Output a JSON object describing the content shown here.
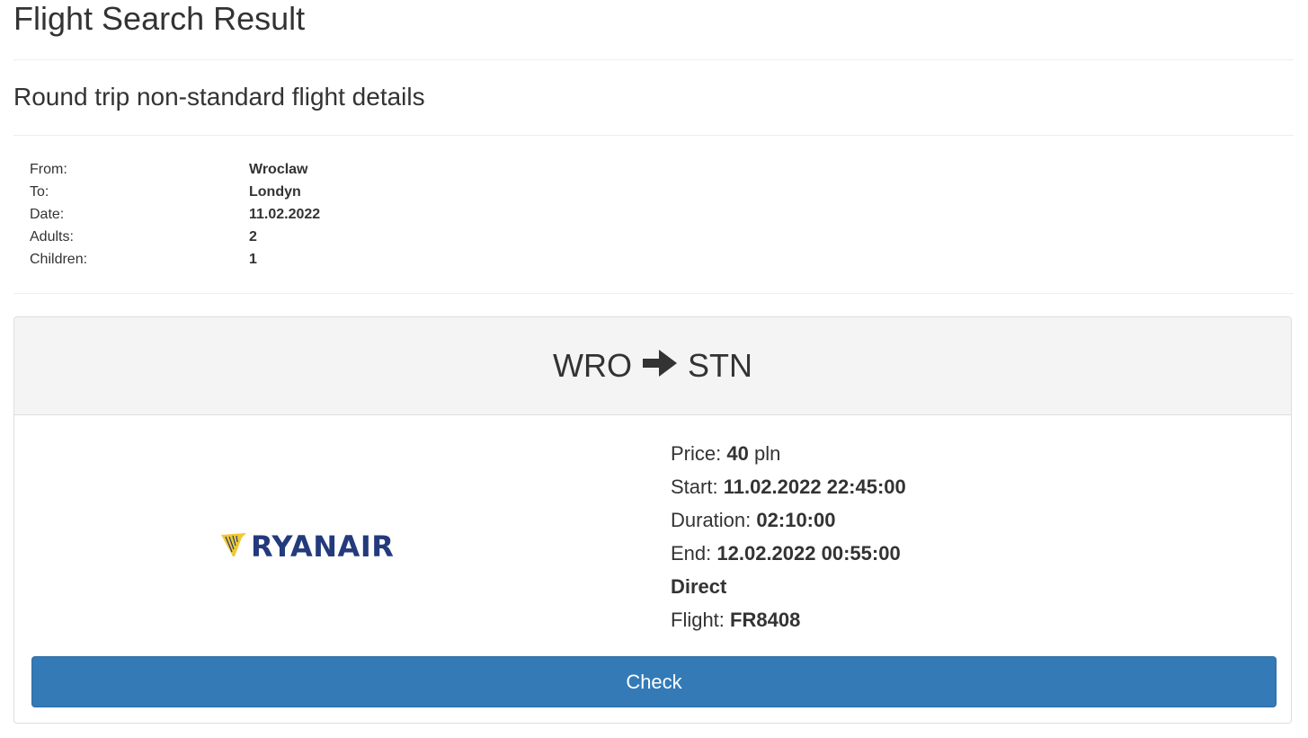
{
  "header": {
    "title": "Flight Search Result",
    "subtitle": "Round trip non-standard flight details"
  },
  "search_details": [
    {
      "label": "From:",
      "value": "Wroclaw"
    },
    {
      "label": "To:",
      "value": "Londyn"
    },
    {
      "label": "Date:",
      "value": "11.02.2022"
    },
    {
      "label": "Adults:",
      "value": "2"
    },
    {
      "label": "Children:",
      "value": "1"
    }
  ],
  "flight": {
    "origin": "WRO",
    "destination": "STN",
    "route_icon": "arrow-right-icon",
    "airline_logo_text": "RYANAIR",
    "airline_logo_icon": "ryanair-harp-icon",
    "price_label": "Price:",
    "price_value": "40",
    "price_currency": "pln",
    "start_label": "Start:",
    "start_value": "11.02.2022 22:45:00",
    "duration_label": "Duration:",
    "duration_value": "02:10:00",
    "end_label": "End:",
    "end_value": "12.02.2022 00:55:00",
    "type": "Direct",
    "flight_label": "Flight:",
    "flight_value": "FR8408",
    "check_label": "Check"
  },
  "colors": {
    "primary_button": "#337ab7",
    "logo_blue": "#233a7c",
    "logo_gold": "#f1c933",
    "card_header_bg": "#f4f4f4"
  }
}
